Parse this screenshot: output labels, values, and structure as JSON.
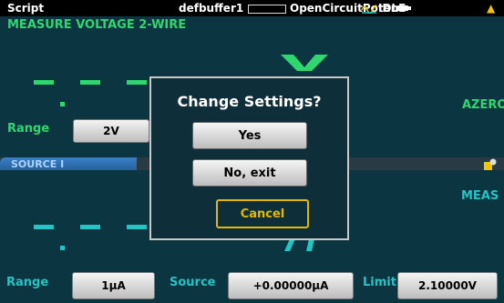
{
  "status_bar": {
    "script_label": "Script",
    "buffer_label": "defbuffer1",
    "test_name": "OpenCircuitPoten",
    "state": "IDLE"
  },
  "measure": {
    "title": "MEASURE VOLTAGE 2-WIRE",
    "azero_label": "AZERO",
    "range_label": "Range",
    "range_value": "2V"
  },
  "source": {
    "tab_label": "SOURCE I",
    "meas_label": "MEAS",
    "range_label": "Range",
    "range_value": "1µA",
    "source_label": "Source",
    "source_value": "+0.00000µA",
    "limit_label": "Limit",
    "limit_value": "2.10000V"
  },
  "dialog": {
    "title": "Change Settings?",
    "yes_label": "Yes",
    "no_label": "No, exit",
    "cancel_label": "Cancel"
  },
  "colors": {
    "measure_accent": "#2fd86f",
    "source_accent": "#25c4c4",
    "warning": "#f5c400",
    "cancel_border": "#e4b800"
  },
  "icons": [
    "wave-icon",
    "battery-icon",
    "warning-icon",
    "settings-icon"
  ]
}
